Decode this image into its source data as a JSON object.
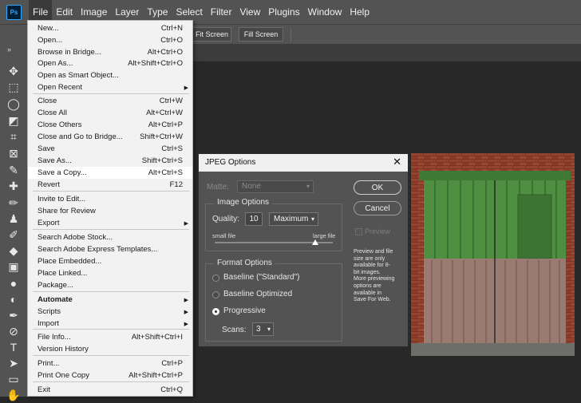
{
  "menubar": {
    "logo": "Ps",
    "items": [
      "File",
      "Edit",
      "Image",
      "Layer",
      "Type",
      "Select",
      "Filter",
      "View",
      "Plugins",
      "Window",
      "Help"
    ]
  },
  "options_bar": {
    "fit_screen": "Fit Screen",
    "fill_screen": "Fill Screen"
  },
  "file_menu": {
    "items": [
      {
        "label": "New...",
        "shortcut": "Ctrl+N"
      },
      {
        "label": "Open...",
        "shortcut": "Ctrl+O"
      },
      {
        "label": "Browse in Bridge...",
        "shortcut": "Alt+Ctrl+O"
      },
      {
        "label": "Open As...",
        "shortcut": "Alt+Shift+Ctrl+O"
      },
      {
        "label": "Open as Smart Object...",
        "shortcut": ""
      },
      {
        "label": "Open Recent",
        "shortcut": "",
        "submenu": true
      },
      {
        "label": "Close",
        "shortcut": "Ctrl+W"
      },
      {
        "label": "Close All",
        "shortcut": "Alt+Ctrl+W"
      },
      {
        "label": "Close Others",
        "shortcut": "Alt+Ctrl+P"
      },
      {
        "label": "Close and Go to Bridge...",
        "shortcut": "Shift+Ctrl+W"
      },
      {
        "label": "Save",
        "shortcut": "Ctrl+S"
      },
      {
        "label": "Save As...",
        "shortcut": "Shift+Ctrl+S"
      },
      {
        "label": "Save a Copy...",
        "shortcut": "Alt+Ctrl+S",
        "highlighted": true
      },
      {
        "label": "Revert",
        "shortcut": "F12"
      },
      {
        "label": "Invite to Edit...",
        "shortcut": ""
      },
      {
        "label": "Share for Review",
        "shortcut": ""
      },
      {
        "label": "Export",
        "shortcut": "",
        "submenu": true
      },
      {
        "label": "Search Adobe Stock...",
        "shortcut": ""
      },
      {
        "label": "Search Adobe Express Templates...",
        "shortcut": ""
      },
      {
        "label": "Place Embedded...",
        "shortcut": ""
      },
      {
        "label": "Place Linked...",
        "shortcut": ""
      },
      {
        "label": "Package...",
        "shortcut": ""
      },
      {
        "label": "Automate",
        "shortcut": "",
        "submenu": true,
        "bold": true
      },
      {
        "label": "Scripts",
        "shortcut": "",
        "submenu": true
      },
      {
        "label": "Import",
        "shortcut": "",
        "submenu": true
      },
      {
        "label": "File Info...",
        "shortcut": "Alt+Shift+Ctrl+I"
      },
      {
        "label": "Version History",
        "shortcut": ""
      },
      {
        "label": "Print...",
        "shortcut": "Ctrl+P"
      },
      {
        "label": "Print One Copy",
        "shortcut": "Alt+Shift+Ctrl+P"
      },
      {
        "label": "Exit",
        "shortcut": "Ctrl+Q"
      }
    ]
  },
  "dialog": {
    "title": "JPEG Options",
    "close": "✕",
    "matte_label": "Matte:",
    "matte_value": "None",
    "image_options": {
      "title": "Image Options",
      "quality_label": "Quality:",
      "quality_value": "10",
      "quality_preset": "Maximum",
      "small_file": "small file",
      "large_file": "large file",
      "slider_level": 0.85
    },
    "format_options": {
      "title": "Format Options",
      "options": [
        "Baseline (\"Standard\")",
        "Baseline Optimized",
        "Progressive"
      ],
      "selected": "Progressive",
      "scans_label": "Scans:",
      "scans_value": "3"
    },
    "ok": "OK",
    "cancel": "Cancel",
    "preview_label": "Preview",
    "info_text": "Preview and file\nsize are only\navailable for 8-\nbit images.\nMore previewing\noptions are\navailable in\nSave For Web."
  },
  "colors": {
    "chrome": "#535353",
    "canvas": "#282828",
    "menu_bg": "#f2f2f2",
    "door_green": "#4a8a3c",
    "brick": "#8a3a2a"
  }
}
